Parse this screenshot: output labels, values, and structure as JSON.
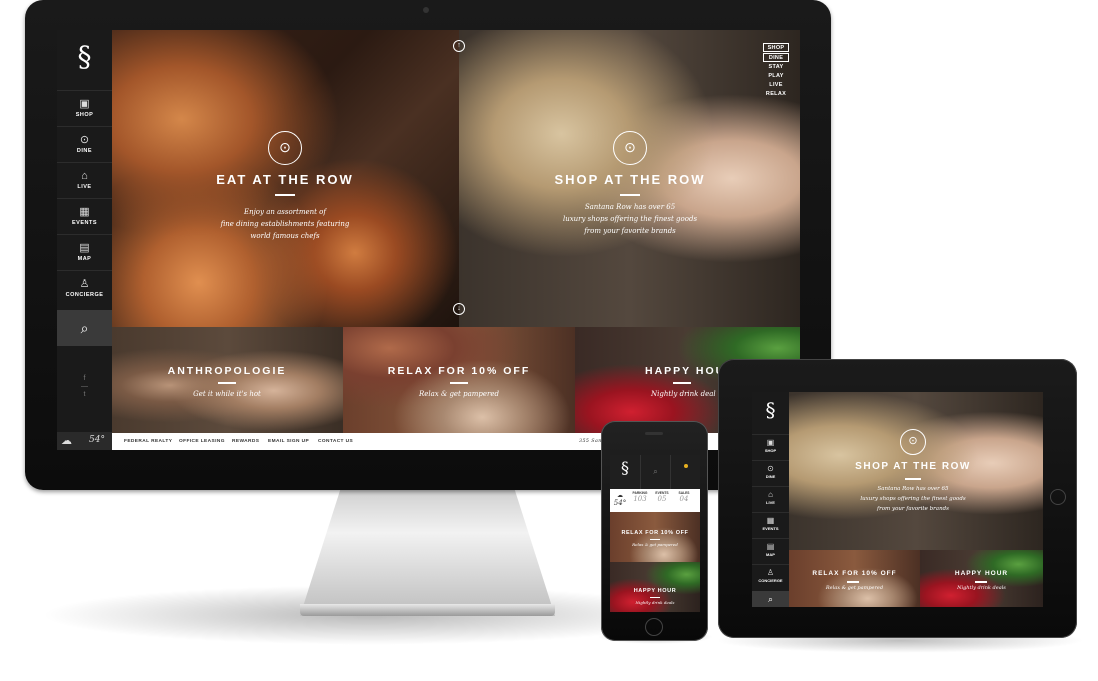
{
  "brand": {
    "logo_glyph": "§"
  },
  "sidebar": {
    "items": [
      {
        "label": "SHOP",
        "icon": "shopping-bag-icon",
        "glyph": "▣"
      },
      {
        "label": "DINE",
        "icon": "plate-icon",
        "glyph": "⊙"
      },
      {
        "label": "LIVE",
        "icon": "home-icon",
        "glyph": "⌂"
      },
      {
        "label": "EVENTS",
        "icon": "calendar-icon",
        "glyph": "▦"
      },
      {
        "label": "MAP",
        "icon": "map-icon",
        "glyph": "▤"
      },
      {
        "label": "CONCIERGE",
        "icon": "person-icon",
        "glyph": "♙"
      }
    ],
    "search_glyph": "⌕",
    "social": [
      "f",
      "—",
      "t"
    ],
    "weather_glyph": "☁",
    "temperature": "54°"
  },
  "hero": {
    "left": {
      "title": "EAT AT THE ROW",
      "subtitle": [
        "Enjoy an assortment of",
        "fine dining establishments featuring",
        "world famous chefs"
      ],
      "icon_glyph": "⊙"
    },
    "right": {
      "title": "SHOP AT THE ROW",
      "subtitle": [
        "Santana Row has over 65",
        "luxury shops offering the finest goods",
        "from your favorite brands"
      ],
      "icon_glyph": "⊙"
    },
    "arrow_up": "↑",
    "arrow_down": "↓"
  },
  "topnav": [
    "SHOP",
    "DINE",
    "STAY",
    "PLAY",
    "LIVE",
    "RELAX"
  ],
  "bottom_panels": [
    {
      "title": "ANTHROPOLOGIE",
      "subtitle": "Get it while it's hot"
    },
    {
      "title": "RELAX FOR 10% OFF",
      "subtitle": "Relax & get pampered"
    },
    {
      "title": "HAPPY HOU",
      "subtitle": "Nightly drink deal"
    }
  ],
  "footer": {
    "links": [
      "FEDERAL REALTY",
      "OFFICE LEASING",
      "REWARDS",
      "EMAIL SIGN UP",
      "CONTACT US"
    ],
    "address": "355 Santa"
  },
  "ipad": {
    "hero_title": "SHOP AT THE ROW",
    "hero_subtitle": [
      "Santana Row has over 65",
      "luxury shops offering the finest goods",
      "from your favorite brands"
    ],
    "panels": [
      {
        "title": "RELAX FOR 10% OFF",
        "subtitle": "Relax & get pampered"
      },
      {
        "title": "HAPPY HOUR",
        "subtitle": "Nightly drink deals"
      }
    ]
  },
  "iphone": {
    "temperature": "54°",
    "stats": [
      {
        "label": "PARKING",
        "value": "103"
      },
      {
        "label": "EVENTS",
        "value": "05"
      },
      {
        "label": "SALES",
        "value": "04"
      }
    ],
    "panels": [
      {
        "title": "RELAX FOR 10% OFF",
        "subtitle": "Relax & get pampered"
      },
      {
        "title": "HAPPY HOUR",
        "subtitle": "Nightly drink deals"
      }
    ]
  },
  "apple_logo": ""
}
